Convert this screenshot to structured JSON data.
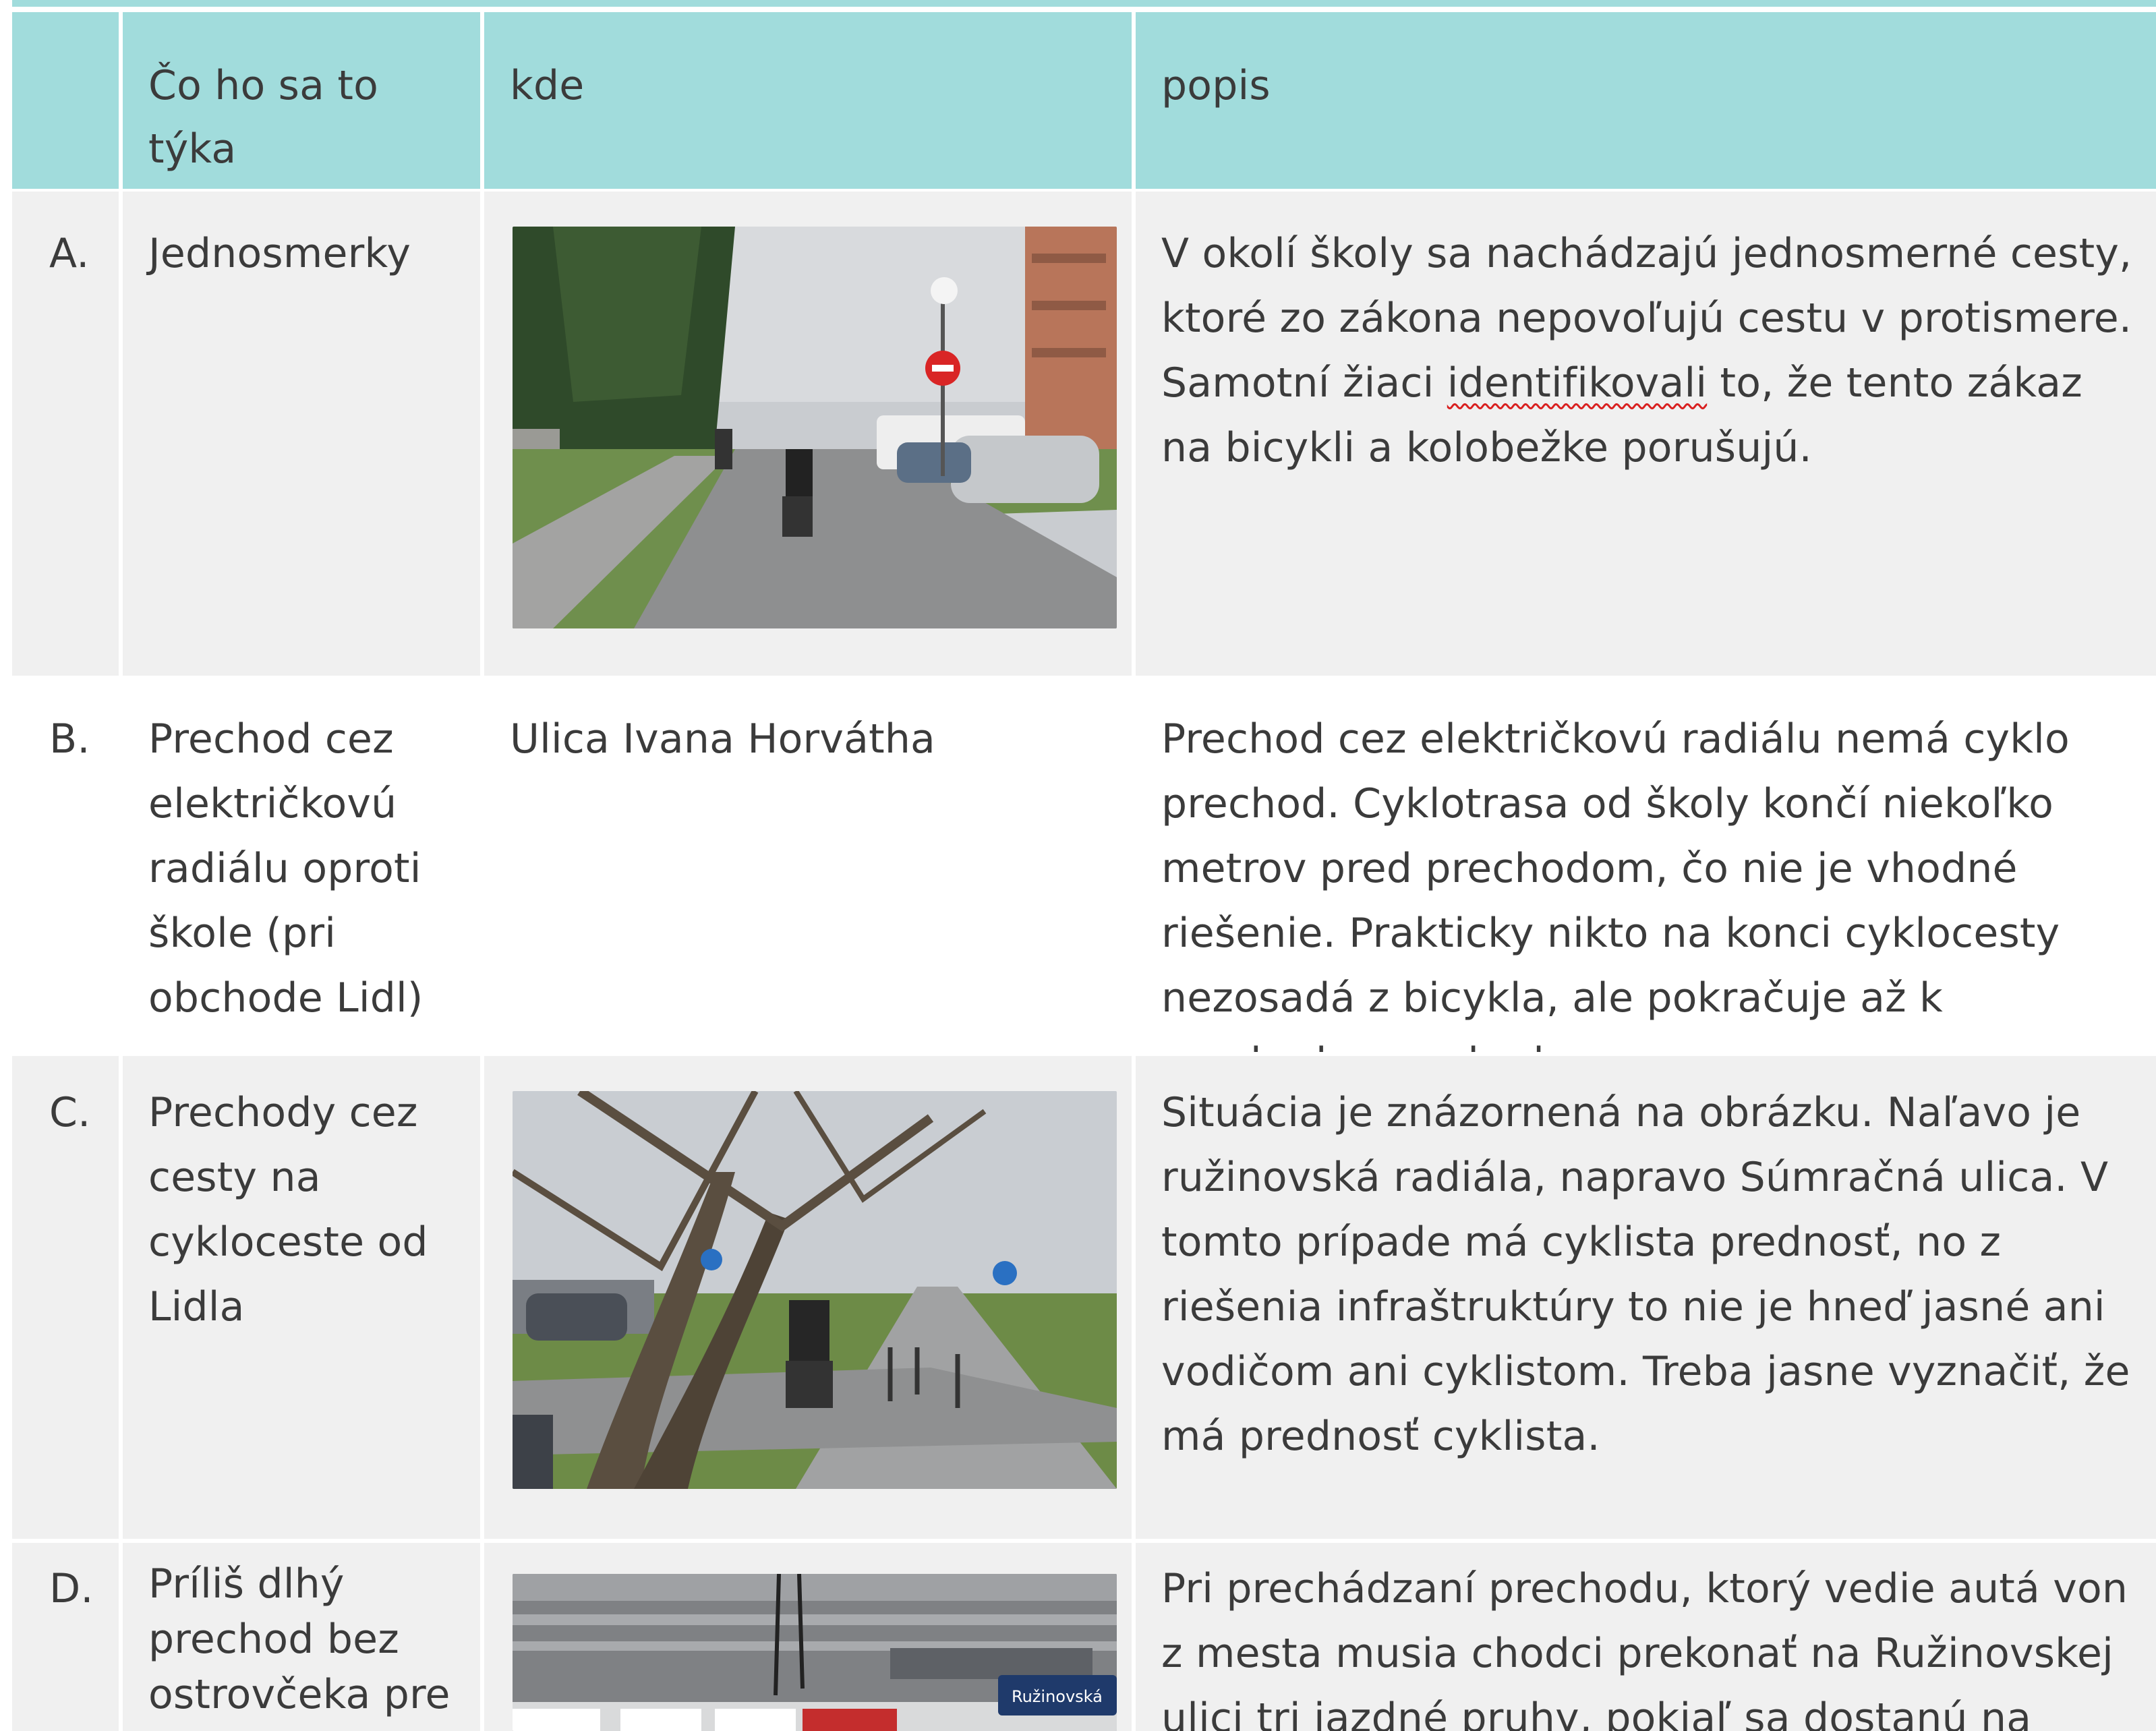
{
  "headers": {
    "col0": "",
    "col1": "Čo ho sa to týka",
    "col2": "kde",
    "col3": "popis"
  },
  "rows": [
    {
      "letter": "A.",
      "topic": "Jednosmerky",
      "where": "",
      "photo": "street-with-cyclists-and-no-entry-sign",
      "desc_a": "V okolí školy sa nachádzajú jednosmerné cesty, ktoré zo zákona nepovoľujú cestu v protismere. Samotní žiaci ",
      "desc_flag": "identifikovali",
      "desc_b": " to, že tento zákaz na bicykli a kolobežke porušujú."
    },
    {
      "letter": "B.",
      "topic": "Prechod cez električkovú radiálu oproti škole (pri obchode Lidl)",
      "where": "Ulica Ivana Horvátha",
      "desc": "Prechod cez električkovú radiálu nemá cyklo prechod. Cyklotrasa od školy končí niekoľko metrov pred prechodom, čo nie je vhodné riešenie. Prakticky nikto na konci cyklocesty nezosadá z bicykla, ale pokračuje až k prechodu pre chodcov."
    },
    {
      "letter": "C.",
      "topic": "Prechody cez cesty na cykloceste od Lidla",
      "where": "",
      "photo": "cycle-path-under-trees",
      "desc": "Situácia je znázornená na obrázku. Naľavo je ružinovská radiála, napravo Súmračná ulica. V tomto prípade má cyklista prednosť, no z riešenia infraštruktúry to nie je hneď jasné ani vodičom ani cyklistom. Treba jasne vyznačiť, že má prednosť cyklista."
    },
    {
      "letter": "D.",
      "topic": "Príliš dlhý prechod bez ostrovčeka pre",
      "where": "",
      "photo": "long-pedestrian-crossing",
      "photo_caption": "Ružinovská",
      "desc": "Pri prechádzaní prechodu, ktorý vedie autá von z mesta musia chodci prekonať na Ružinovskej ulici tri jazdné pruhy, pokiaľ sa dostanú na druhú stranu."
    }
  ],
  "colors": {
    "header_bg": "#a1dcdc",
    "row_bg": "#f0f0f0",
    "text": "#3b3b3b",
    "spellcheck": "#d92020"
  }
}
